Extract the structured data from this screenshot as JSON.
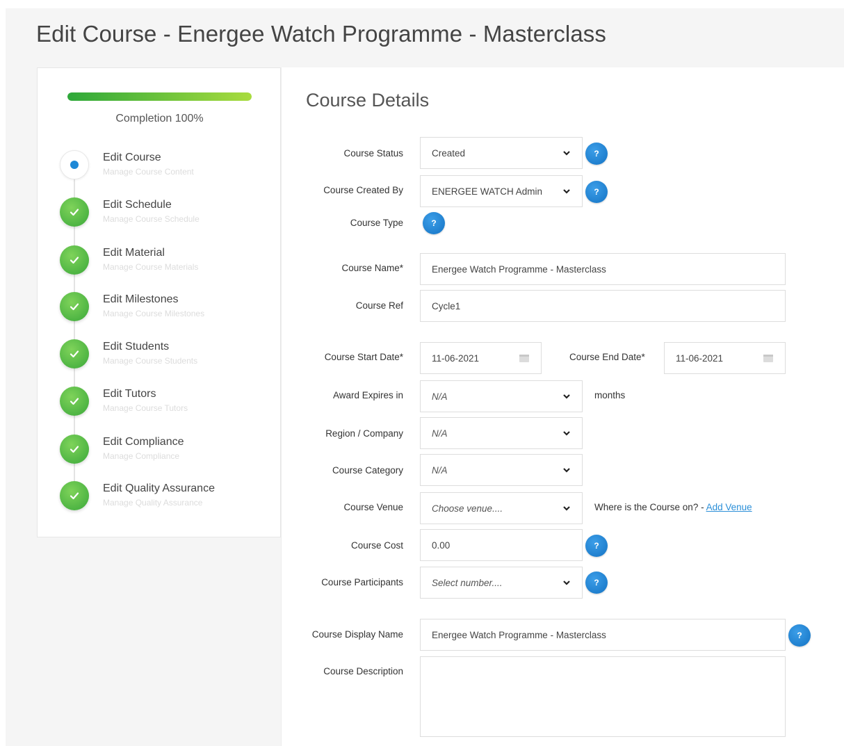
{
  "page_title": "Edit Course - Energee Watch Programme - Masterclass",
  "sidebar": {
    "progress": 1.0,
    "completion_label": "Completion 100%",
    "steps": [
      {
        "title": "Edit Course",
        "subtitle": "Manage Course Content",
        "state": "current"
      },
      {
        "title": "Edit Schedule",
        "subtitle": "Manage Course Schedule",
        "state": "done"
      },
      {
        "title": "Edit Material",
        "subtitle": "Manage Course Materials",
        "state": "done"
      },
      {
        "title": "Edit Milestones",
        "subtitle": "Manage Course Milestones",
        "state": "done"
      },
      {
        "title": "Edit Students",
        "subtitle": "Manage Course Students",
        "state": "done"
      },
      {
        "title": "Edit Tutors",
        "subtitle": "Manage Course Tutors",
        "state": "done"
      },
      {
        "title": "Edit Compliance",
        "subtitle": "Manage Compliance",
        "state": "done"
      },
      {
        "title": "Edit Quality Assurance",
        "subtitle": "Manage Quality Assurance",
        "state": "done"
      }
    ]
  },
  "form": {
    "section_title": "Course Details",
    "help_icon_glyph": "?",
    "course_status": {
      "label": "Course Status",
      "value": "Created"
    },
    "created_by": {
      "label": "Course Created By",
      "value": "ENERGEE WATCH Admin"
    },
    "course_type": {
      "label": "Course Type"
    },
    "course_name": {
      "label": "Course Name*",
      "value": "Energee Watch Programme - Masterclass"
    },
    "course_ref": {
      "label": "Course Ref",
      "value": "Cycle1"
    },
    "start_date": {
      "label": "Course Start Date*",
      "value": "11-06-2021"
    },
    "end_date": {
      "label": "Course End Date*",
      "value": "11-06-2021"
    },
    "award_expires": {
      "label": "Award Expires in",
      "value": "N/A",
      "suffix": "months"
    },
    "region": {
      "label": "Region / Company",
      "value": "N/A"
    },
    "category": {
      "label": "Course Category",
      "value": "N/A"
    },
    "venue": {
      "label": "Course Venue",
      "placeholder": "Choose venue....",
      "hint": "Where is the Course on? - ",
      "add_link": "Add Venue"
    },
    "cost": {
      "label": "Course Cost",
      "value": "0.00"
    },
    "participants": {
      "label": "Course Participants",
      "placeholder": "Select number...."
    },
    "display_name": {
      "label": "Course Display Name",
      "value": "Energee Watch Programme - Masterclass"
    },
    "description": {
      "label": "Course Description",
      "value": ""
    }
  },
  "colors": {
    "progress_start": "#2ea83a",
    "progress_end": "#a9dc3e",
    "help_blue": "#1e88d6",
    "done_green": "#3aa83a",
    "link_blue": "#2b8fd8"
  }
}
